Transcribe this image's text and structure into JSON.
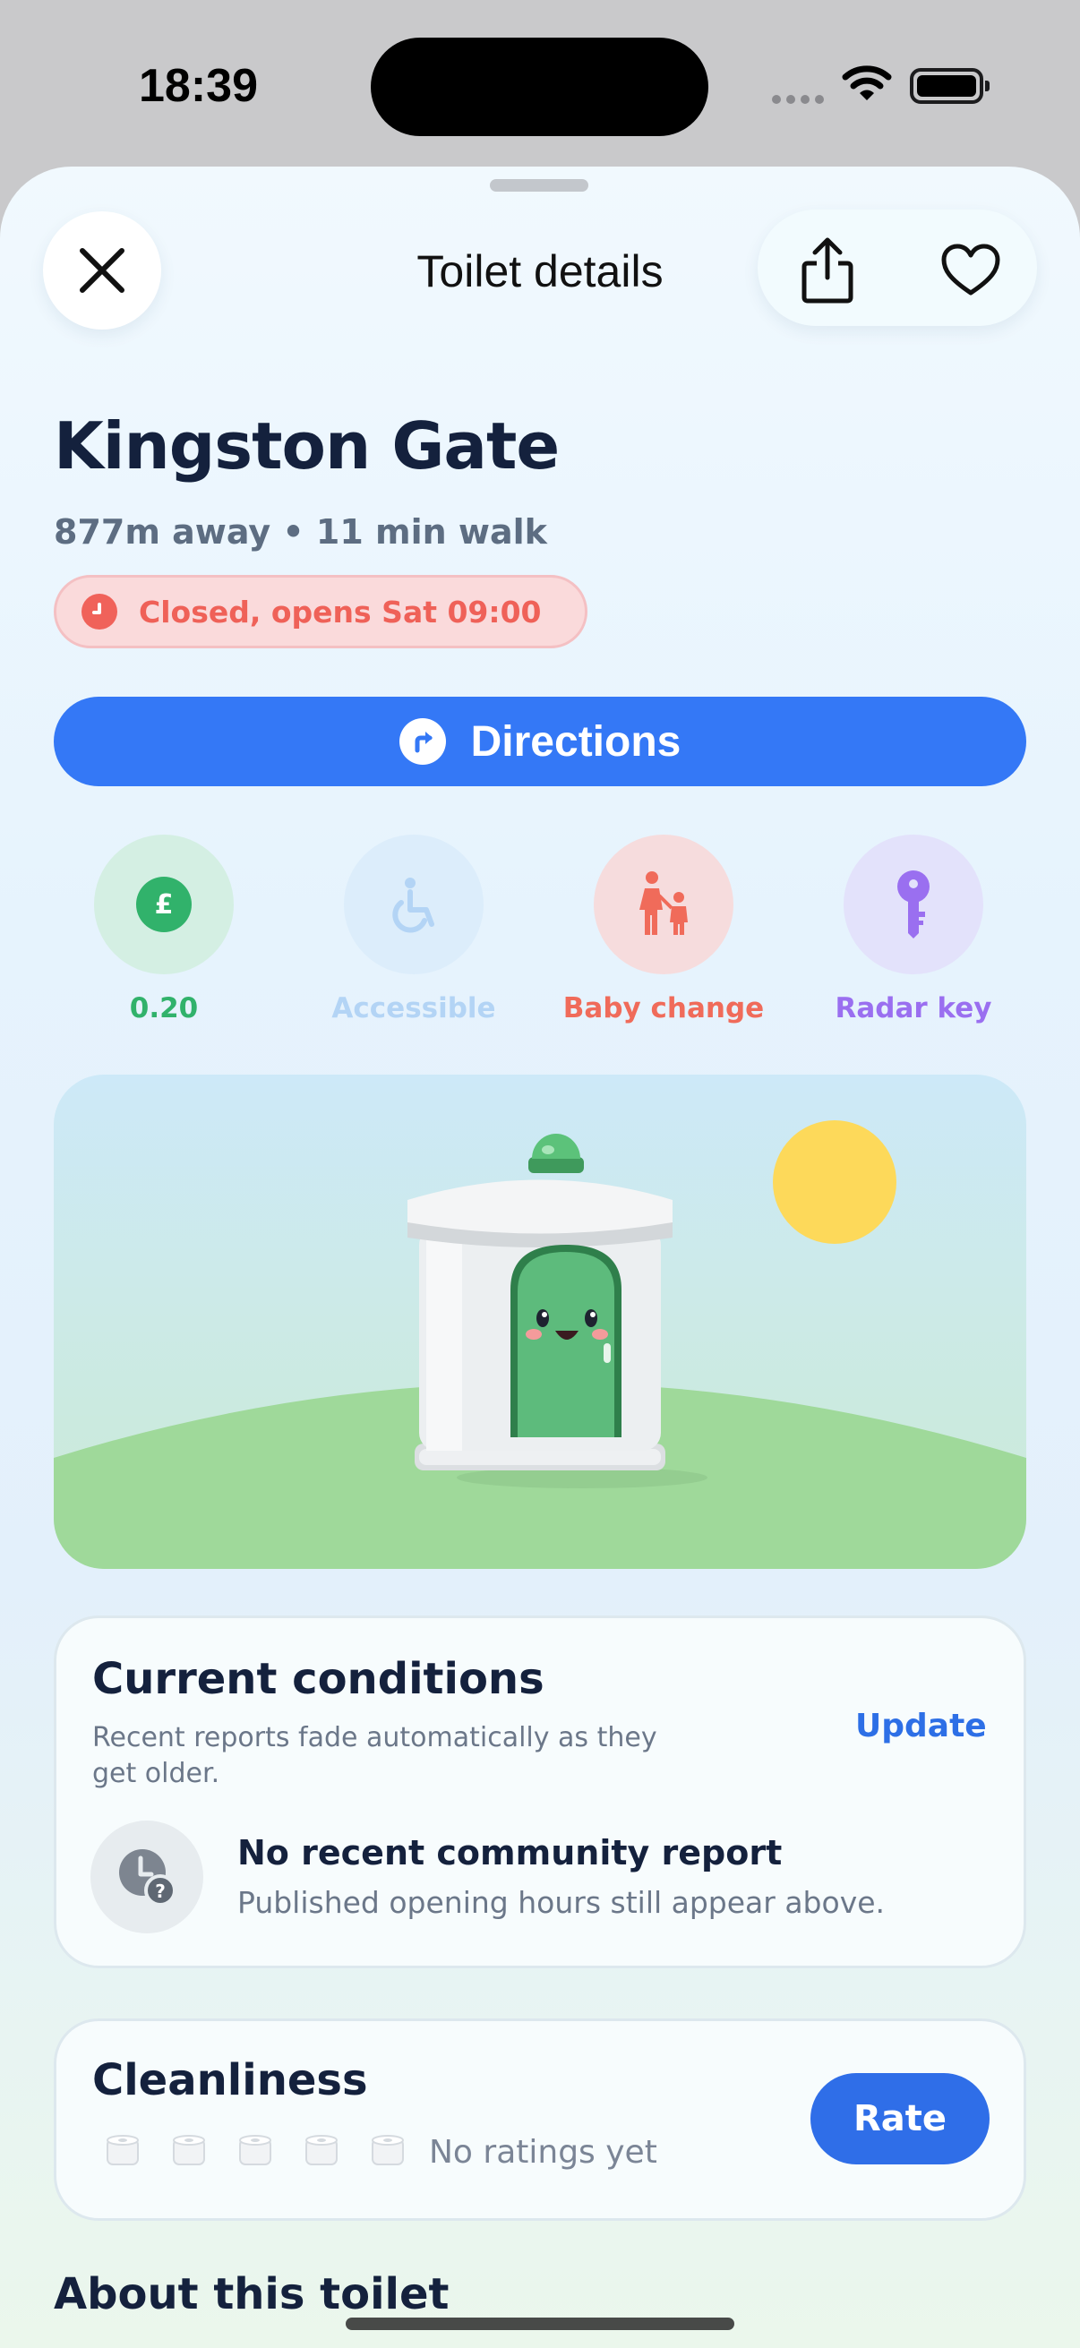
{
  "status_bar": {
    "time": "18:39"
  },
  "header": {
    "title": "Toilet details",
    "close_icon": "close-icon",
    "share_icon": "share-icon",
    "favorite_icon": "heart-icon"
  },
  "place": {
    "name": "Kingston Gate",
    "distance": "877m away • 11 min walk",
    "status": "Closed, opens Sat 09:00"
  },
  "directions": {
    "label": "Directions"
  },
  "features": [
    {
      "label": "0.20",
      "icon": "pound-icon",
      "color": "#31b26b",
      "bg": "#d4efe3"
    },
    {
      "label": "Accessible",
      "icon": "wheelchair-icon",
      "color": "#b3d4f5",
      "bg": "#dcedfb"
    },
    {
      "label": "Baby change",
      "icon": "parent-child-icon",
      "color": "#f06b5a",
      "bg": "#f6dcdd"
    },
    {
      "label": "Radar key",
      "icon": "key-icon",
      "color": "#9a6ff0",
      "bg": "#e3e2fb"
    }
  ],
  "conditions": {
    "title": "Current conditions",
    "subtitle_line1": "Recent reports fade automatically as they",
    "subtitle_line2": "get older.",
    "update_label": "Update",
    "report_title": "No recent community report",
    "report_subtitle": "Published opening hours still appear above."
  },
  "cleanliness": {
    "title": "Cleanliness",
    "rating": 0,
    "rating_max": 5,
    "no_ratings": "No ratings yet",
    "rate_label": "Rate"
  },
  "about": {
    "title": "About this toilet"
  }
}
